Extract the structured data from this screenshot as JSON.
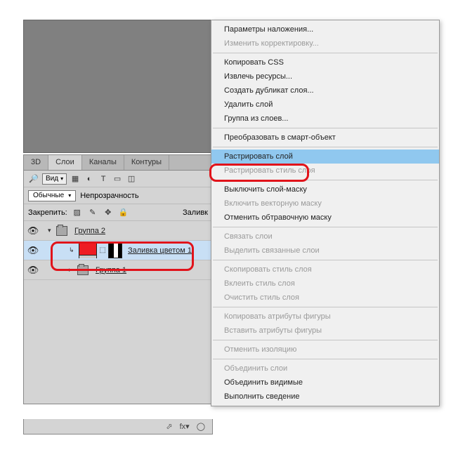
{
  "panel": {
    "tabs": [
      "3D",
      "Слои",
      "Каналы",
      "Контуры"
    ],
    "active_tab": 1,
    "filter_label": "Вид",
    "blend_mode": "Обычные",
    "opacity_label": "Непрозрачность",
    "lock_label": "Закрепить:",
    "fill_label": "Заливк"
  },
  "layers": {
    "group2": "Группа 2",
    "fill_layer": "Заливка цветом 1",
    "group1": "Группа 1"
  },
  "menu": {
    "items": [
      {
        "label": "Параметры наложения...",
        "enabled": true
      },
      {
        "label": "Изменить корректировку...",
        "enabled": false
      },
      {
        "sep": true
      },
      {
        "label": "Копировать CSS",
        "enabled": true
      },
      {
        "label": "Извлечь ресурсы...",
        "enabled": true
      },
      {
        "label": "Создать дубликат слоя...",
        "enabled": true
      },
      {
        "label": "Удалить слой",
        "enabled": true
      },
      {
        "label": "Группа из слоев...",
        "enabled": true
      },
      {
        "sep": true
      },
      {
        "label": "Преобразовать в смарт-объект",
        "enabled": true
      },
      {
        "sep": true
      },
      {
        "label": "Растрировать слой",
        "enabled": true,
        "highlighted": true
      },
      {
        "label": "Растрировать стиль слоя",
        "enabled": false
      },
      {
        "sep": true
      },
      {
        "label": "Выключить слой-маску",
        "enabled": true
      },
      {
        "label": "Включить векторную маску",
        "enabled": false
      },
      {
        "label": "Отменить обтравочную маску",
        "enabled": true
      },
      {
        "sep": true
      },
      {
        "label": "Связать слои",
        "enabled": false
      },
      {
        "label": "Выделить связанные слои",
        "enabled": false
      },
      {
        "sep": true
      },
      {
        "label": "Скопировать стиль слоя",
        "enabled": false
      },
      {
        "label": "Вклеить стиль слоя",
        "enabled": false
      },
      {
        "label": "Очистить стиль слоя",
        "enabled": false
      },
      {
        "sep": true
      },
      {
        "label": "Копировать атрибуты фигуры",
        "enabled": false
      },
      {
        "label": "Вставить атрибуты фигуры",
        "enabled": false
      },
      {
        "sep": true
      },
      {
        "label": "Отменить изоляцию",
        "enabled": false
      },
      {
        "sep": true
      },
      {
        "label": "Объединить слои",
        "enabled": false
      },
      {
        "label": "Объединить видимые",
        "enabled": true
      },
      {
        "label": "Выполнить сведение",
        "enabled": true
      }
    ]
  }
}
